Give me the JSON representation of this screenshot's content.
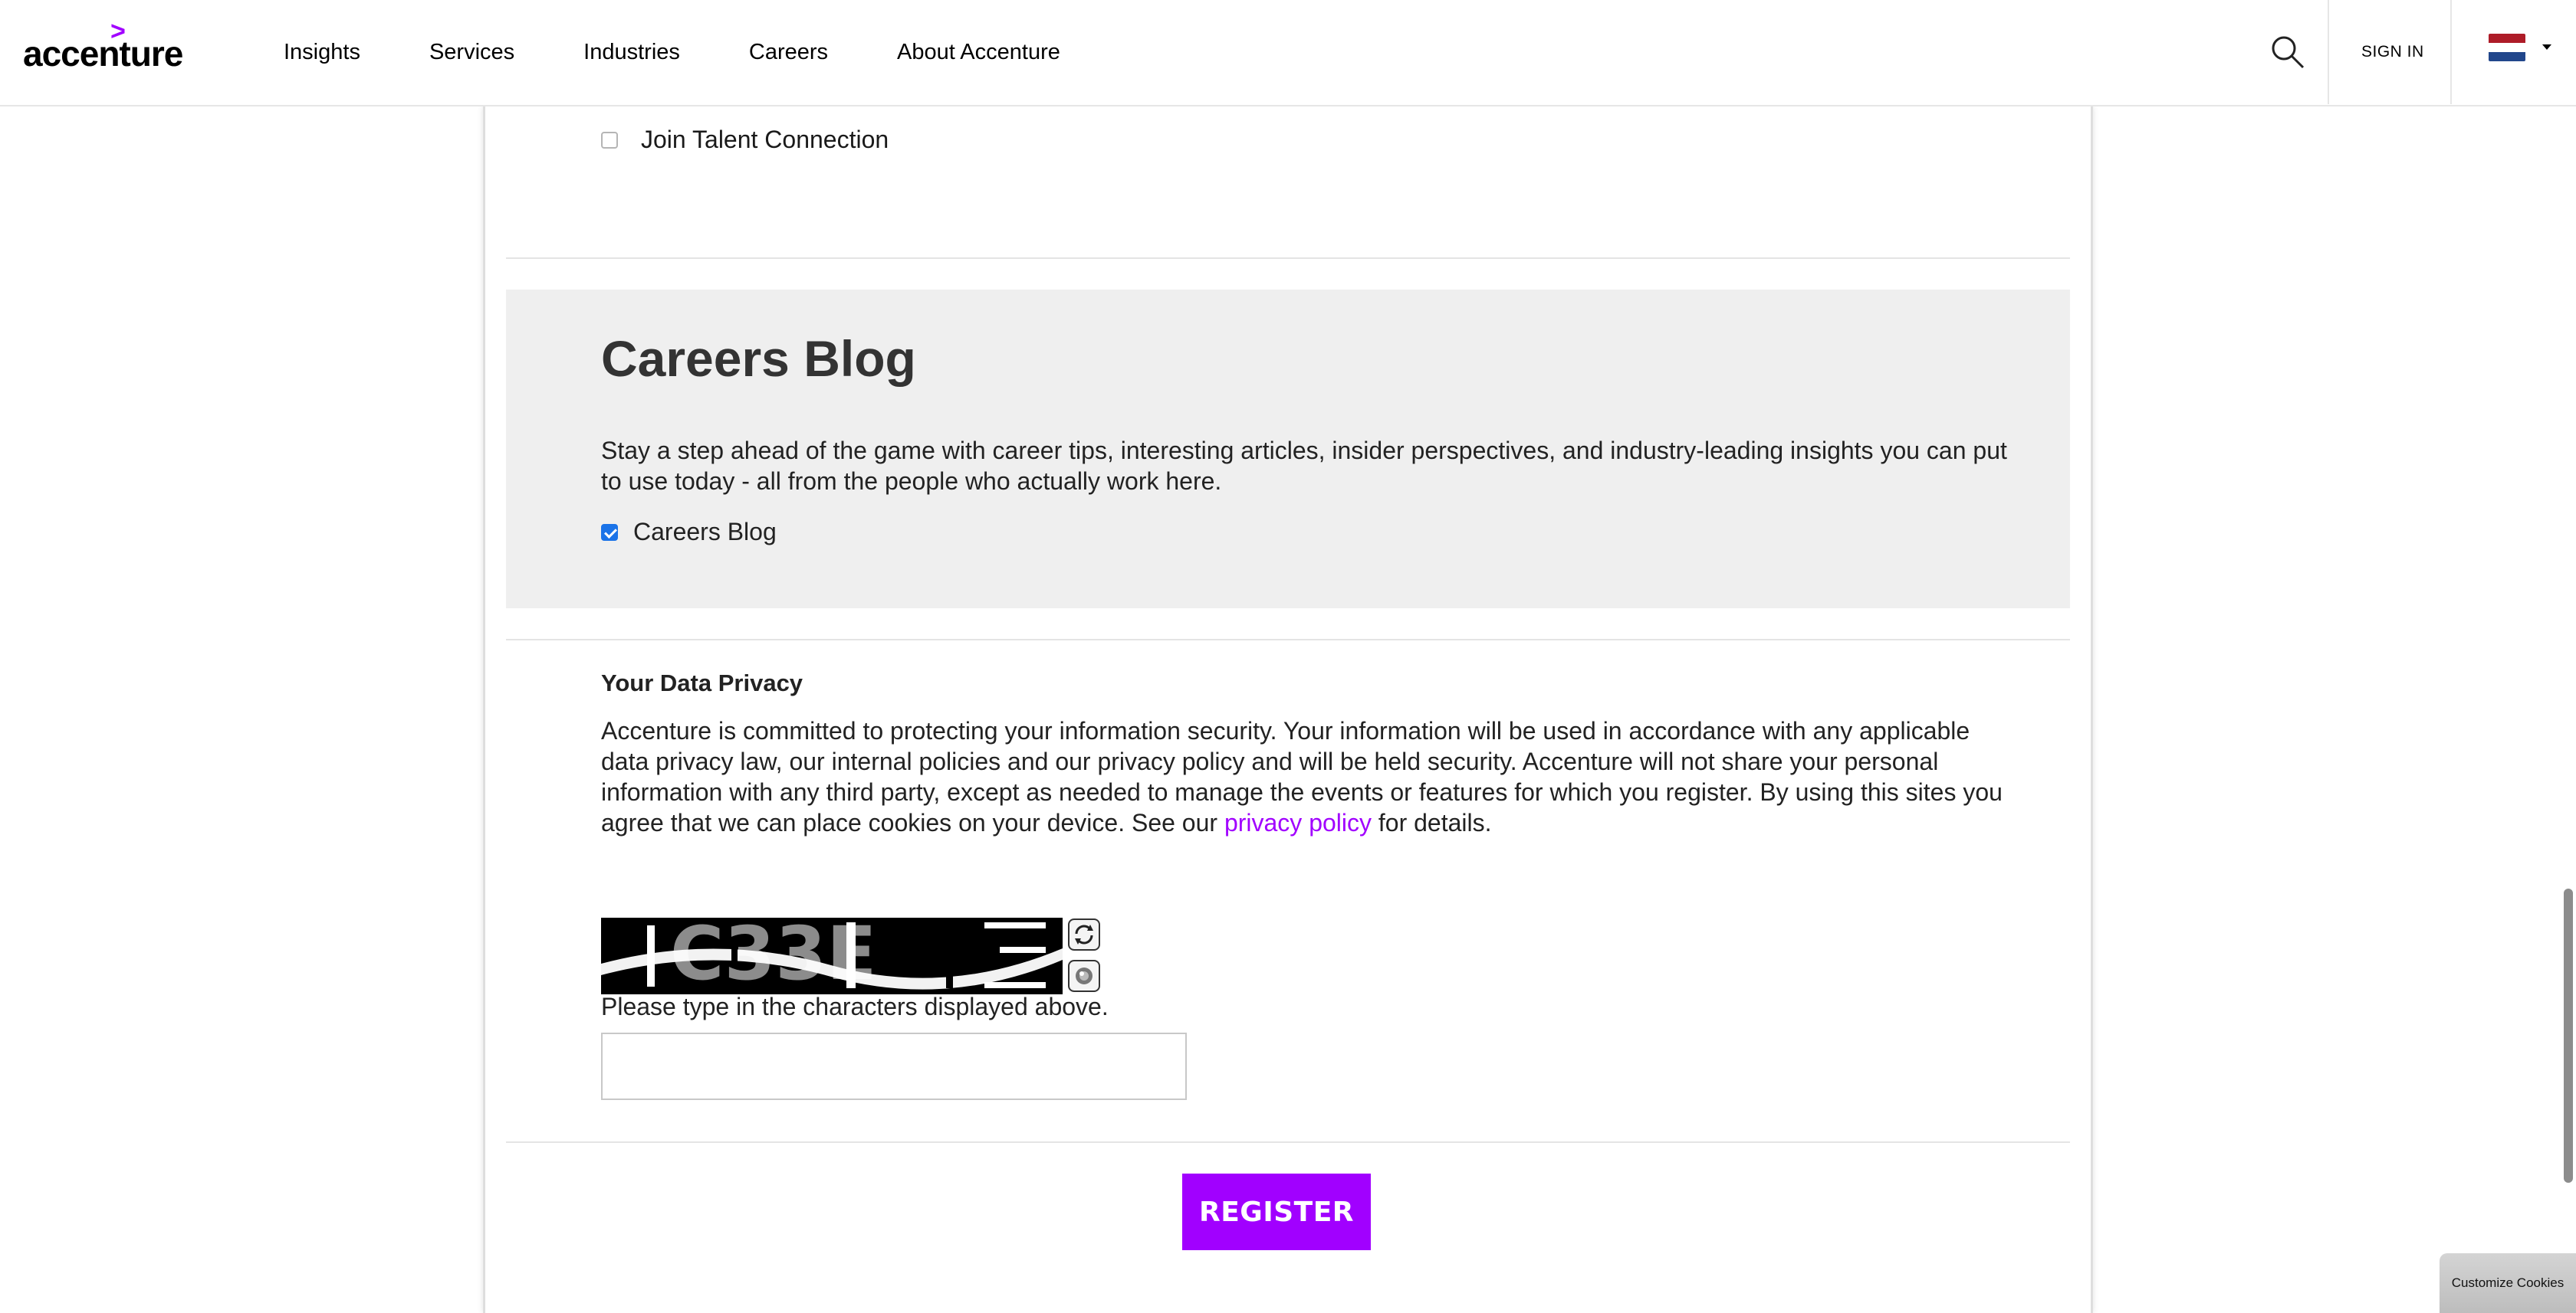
{
  "header": {
    "logo_text": "accenture",
    "logo_mark": ">",
    "nav": [
      "Insights",
      "Services",
      "Industries",
      "Careers",
      "About Accenture"
    ],
    "sign_in": "SIGN IN",
    "search_icon": "search-icon",
    "flag_icon": "netherlands-flag-icon"
  },
  "talent": {
    "checkbox_label": "Join Talent Connection",
    "checked": false
  },
  "blog": {
    "title": "Careers Blog",
    "description": "Stay a step ahead of the game with career tips, interesting articles, insider perspectives, and industry-leading insights you can put to use today - all from the people who actually work here.",
    "checkbox_label": "Careers Blog",
    "checked": true
  },
  "privacy": {
    "title": "Your Data Privacy",
    "text_before_link": "Accenture is committed to protecting your information security. Your information will be used in accordance with any applicable data privacy law, our internal policies and our privacy policy and will be held security. Accenture will not share your personal information with any third party, except as needed to manage the events or features for which you register. By using this sites you agree that we can place cookies on your device. See our ",
    "link_text": "privacy policy",
    "text_after_link": " for details."
  },
  "captcha": {
    "image_text": "C33E",
    "prompt": "Please type in the characters displayed above.",
    "input_value": "",
    "refresh_icon": "refresh-icon",
    "audio_icon": "audio-icon"
  },
  "register_label": "REGISTER",
  "cookie_label": "Customize Cookies",
  "colors": {
    "accent": "#a100ff",
    "blog_bg": "#efefef",
    "checkbox_checked": "#1a73e8"
  }
}
